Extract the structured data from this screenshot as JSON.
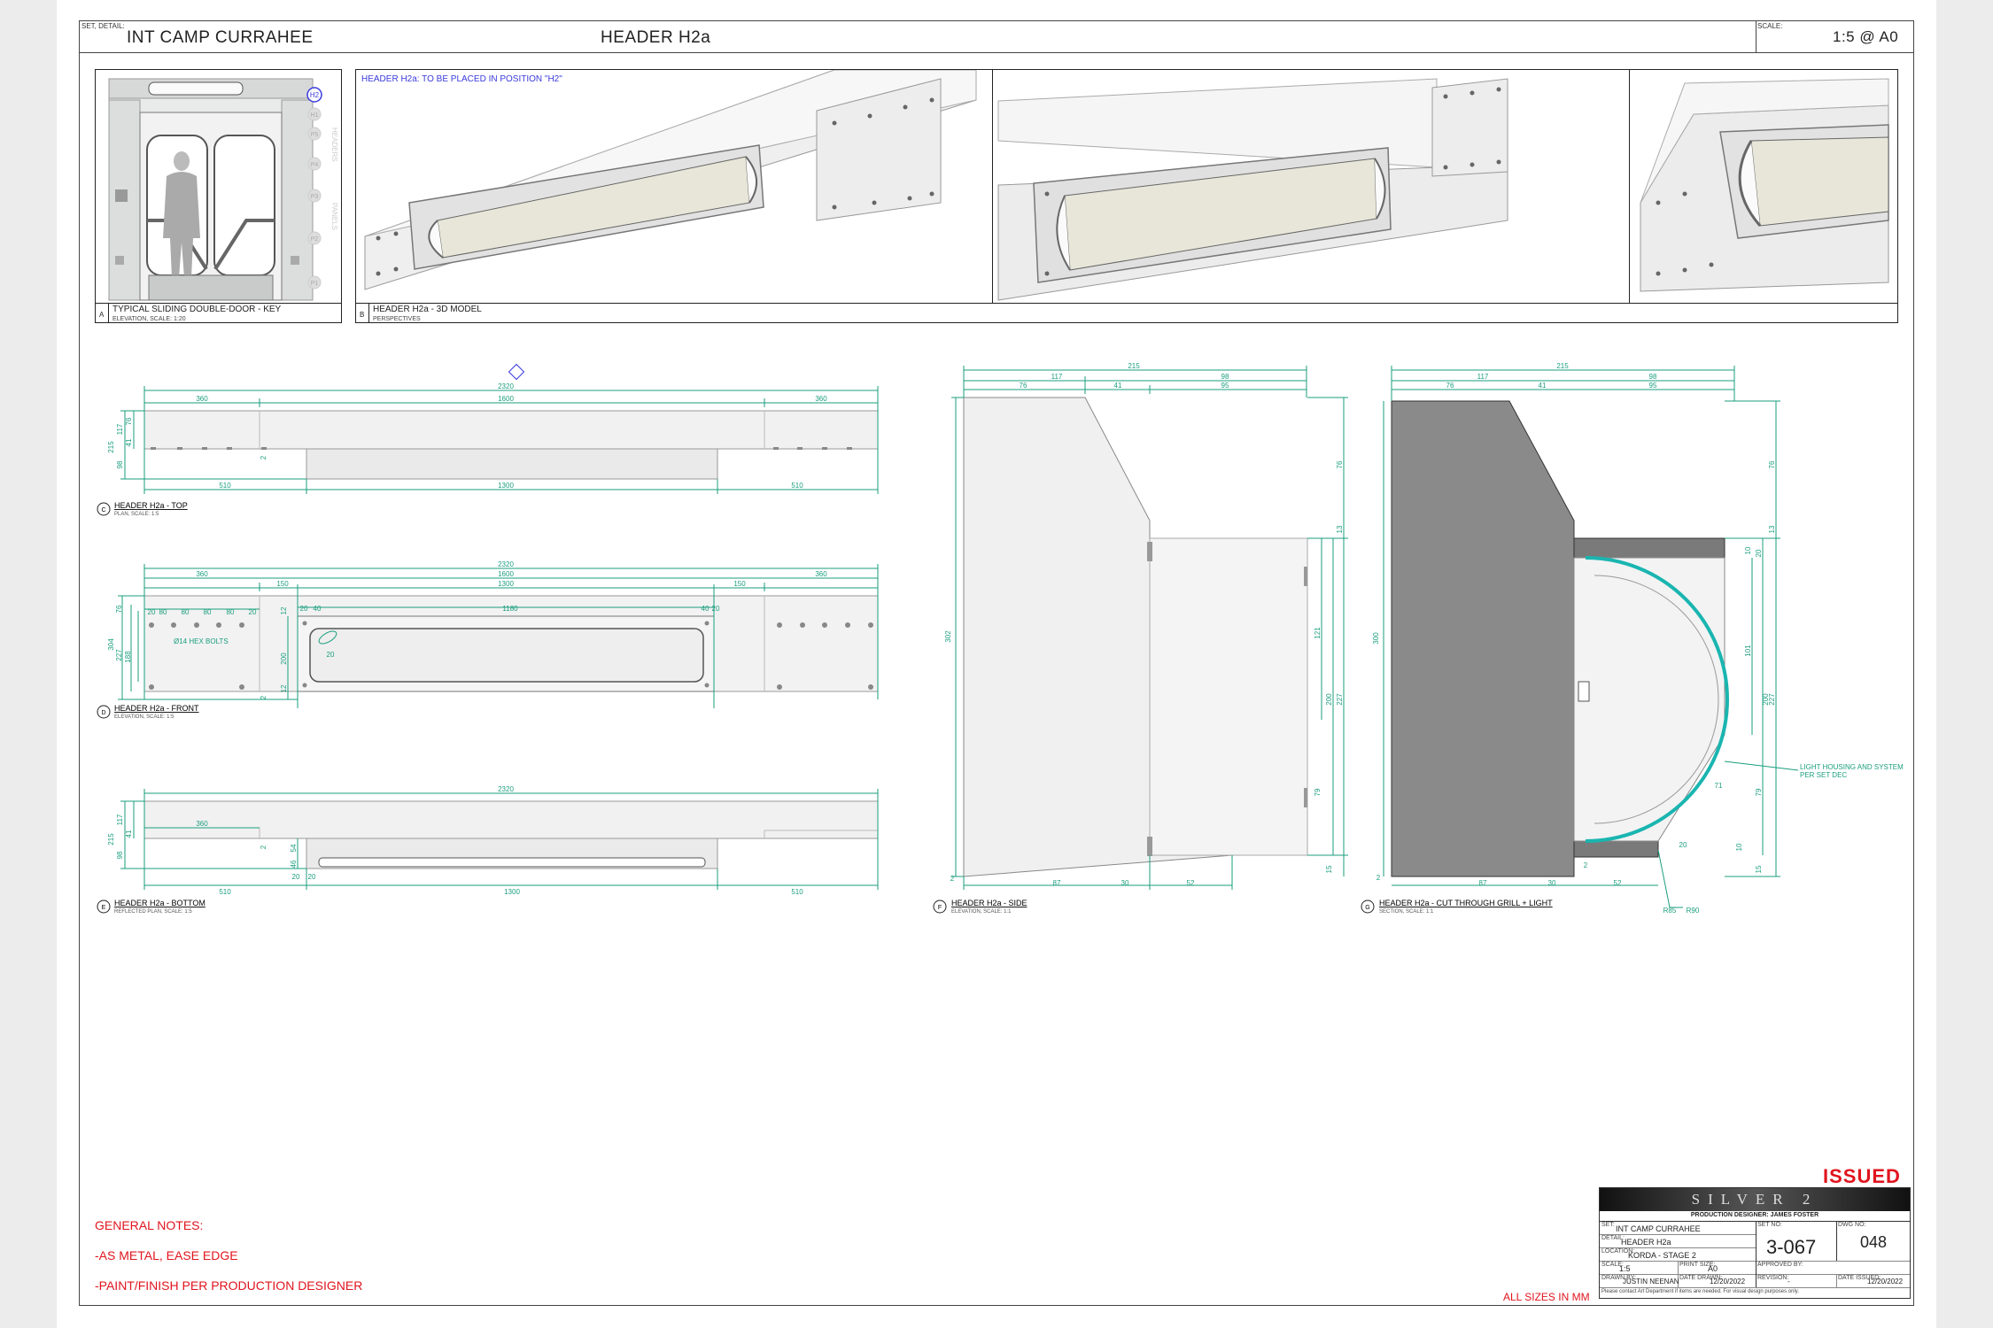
{
  "header": {
    "set_detail_label": "SET, DETAIL:",
    "set_name": "INT CAMP CURRAHEE",
    "detail_name": "HEADER H2a",
    "scale_label": "SCALE:",
    "scale_value": "1:5  @ A0"
  },
  "panel_a": {
    "letter": "A",
    "title": "TYPICAL SLIDING DOUBLE-DOOR - KEY",
    "subtitle": "ELEVATION, SCALE: 1:20",
    "side_label_top": "HEADERS",
    "side_label_bottom": "PANELS",
    "tags": [
      "H2",
      "H1",
      "P5",
      "P4",
      "P3",
      "P2",
      "P1"
    ]
  },
  "panel_b": {
    "letter": "B",
    "title": "HEADER H2a - 3D MODEL",
    "subtitle": "PERSPECTIVES",
    "note": "HEADER H2a: TO BE PLACED IN POSITION \"H2\""
  },
  "views": {
    "c": {
      "letter": "C",
      "title": "HEADER H2a - TOP",
      "subtitle": "PLAN, SCALE: 1:5"
    },
    "d": {
      "letter": "D",
      "title": "HEADER H2a - FRONT",
      "subtitle": "ELEVATION, SCALE: 1:5"
    },
    "e": {
      "letter": "E",
      "title": "HEADER H2a - BOTTOM",
      "subtitle": "REFLECTED PLAN, SCALE: 1:5"
    },
    "f": {
      "letter": "F",
      "title": "HEADER H2a - SIDE",
      "subtitle": "ELEVATION, SCALE: 1:1"
    },
    "g": {
      "letter": "G",
      "title": "HEADER H2a - CUT THROUGH GRILL + LIGHT",
      "subtitle": "SECTION, SCALE: 1:1"
    }
  },
  "dims": {
    "top": {
      "overall": "2320",
      "mid": "1600",
      "end": "360",
      "bot_side": "510",
      "bot_mid": "1300",
      "h1": "215",
      "h2": "117",
      "h3": "41",
      "h4": "98",
      "h5": "2",
      "h6": "76"
    },
    "front": {
      "overall": "2320",
      "mid": "1600",
      "inner": "1300",
      "end": "360",
      "gap": "150",
      "slot": "1180",
      "pitch": "80",
      "edge": "20",
      "small": "40",
      "h1": "304",
      "h2": "227",
      "h3": "188",
      "h4": "76",
      "h5": "200",
      "h6": "12",
      "h7": "2",
      "bolt_note": "Ø14 HEX BOLTS"
    },
    "bottom": {
      "overall": "2320",
      "end": "360",
      "side": "510",
      "mid": "1300",
      "h1": "215",
      "h2": "117",
      "h3": "41",
      "h4": "98",
      "h5": "2",
      "h6": "54",
      "h7": "46",
      "h8": "20",
      "h9": "20"
    },
    "side": {
      "w": "215",
      "w1": "117",
      "w2": "98",
      "w3": "76",
      "w4": "41",
      "w5": "95",
      "h": "302",
      "h1": "76",
      "h2": "13",
      "h3": "121",
      "h4": "200",
      "h5": "227",
      "h6": "79",
      "h7": "15",
      "h8": "2",
      "b1": "87",
      "b2": "30",
      "b3": "52"
    },
    "section": {
      "w": "215",
      "w1": "117",
      "w2": "98",
      "w3": "76",
      "w4": "41",
      "w5": "95",
      "h": "300",
      "h1": "76",
      "h2": "13",
      "h3": "10",
      "h4": "20",
      "h5": "101",
      "h6": "200",
      "h7": "227",
      "h8": "79",
      "h9": "10",
      "h10": "15",
      "b1": "87",
      "b2": "30",
      "b3": "52",
      "r1": "R85",
      "r2": "R90",
      "r3": "71",
      "r4": "20",
      "r5": "2",
      "s1": "2",
      "note": "LIGHT HOUSING AND SYSTEM PER SET DEC"
    }
  },
  "notes": {
    "title": "GENERAL NOTES:",
    "items": [
      "-AS METAL, EASE EDGE",
      "-PAINT/FINISH PER PRODUCTION DESIGNER"
    ],
    "sizes": "ALL SIZES IN MM"
  },
  "title_block": {
    "status": "ISSUED",
    "logo": "SILVER 2",
    "designer": "PRODUCTION DESIGNER: JAMES FOSTER",
    "set_label": "SET:",
    "set": "INT CAMP CURRAHEE",
    "detail_label": "DETAIL:",
    "detail": "HEADER H2a",
    "location_label": "LOCATION:",
    "location": "KORDA - STAGE 2",
    "scale_label": "SCALE:",
    "scale": "1:5",
    "print_label": "PRINT SIZE:",
    "print": "A0",
    "approved_label": "APPROVED BY:",
    "drawn_label": "DRAWN BY:",
    "drawn": "JUSTIN NEENAN",
    "date_drawn_label": "DATE DRAWN:",
    "date_drawn": "12/20/2022",
    "revision_label": "REVISION:",
    "revision": "-",
    "date_issued_label": "DATE ISSUED:",
    "date_issued": "12/20/2022",
    "set_no_label": "SET NO:",
    "set_no": "3-067",
    "dwg_no_label": "DWG NO:",
    "dwg_no": "048",
    "disclaimer": "Please contact Art Department if items are needed. For visual design purposes only."
  },
  "colors": {
    "dim": "#1a9e7e",
    "notes": "#e0141e",
    "section_fill": "#8a8a8a",
    "light": "#1ab5b0",
    "note_blue": "#3a3adc"
  }
}
